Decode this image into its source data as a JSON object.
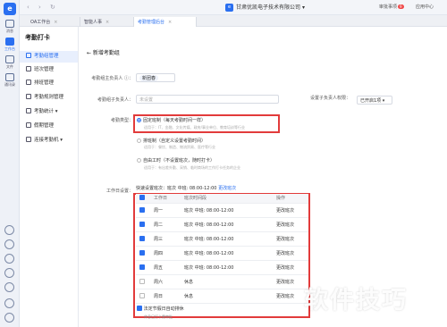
{
  "rail": {
    "logo": "e",
    "items": [
      "消息",
      "工作台",
      "文件",
      "通讯录"
    ],
    "active_index": 1
  },
  "topbar": {
    "nav": "‹ › ↻",
    "company": "甘肃优凯电子技术有限公司",
    "company_suffix": "▾",
    "right_items": [
      {
        "label": "审批事项",
        "badge": "9"
      },
      {
        "label": "应用中心",
        "badge": ""
      }
    ]
  },
  "tabs": [
    {
      "label": "OA工作台",
      "close": "×"
    },
    {
      "label": "智能人事",
      "close": "×"
    },
    {
      "label": "考勤管理后台",
      "close": "×"
    }
  ],
  "sidebar": {
    "title": "考勤打卡",
    "items": [
      {
        "label": "考勤组管理"
      },
      {
        "label": "班次管理"
      },
      {
        "label": "排班管理"
      },
      {
        "label": "考勤规则管理"
      },
      {
        "label": "考勤统计 ▾"
      },
      {
        "label": "假期管理"
      },
      {
        "label": "连接考勤机 ▾"
      }
    ],
    "active_index": 0
  },
  "form": {
    "back_label": "← 新增考勤组",
    "owner_label": "考勤组主负责人 ⓘ：",
    "owner_value": "新团春",
    "sub_owner_label": "考勤组子负责人：",
    "sub_owner_placeholder": "未设置",
    "perm_label": "设置子负责人权限：",
    "perm_value": "已开启1项 ▾",
    "type_label": "考勤类型：",
    "types": [
      {
        "title": "固定班制（每天考勤时间一样）",
        "desc": "适用于：IT、金融、文化传媒、政府/事业单位、教育培训等行业"
      },
      {
        "title": "排班制（自定义设置考勤时间）",
        "desc": "适用于：餐饮、制造、物流贸易、医疗等行业"
      },
      {
        "title": "自由工时（不设置班次，随时打卡）",
        "desc": "适用于：有出差外勤、采销、临时商场的工作打卡任务的企业"
      }
    ],
    "selected_type": 0,
    "workday_label": "工作日设置：",
    "quick_set": "快速设置班次：班次 中班: 08:00-12:00",
    "quick_change": "更改班次",
    "table_headers": [
      "工作日",
      "班次时间段",
      "操作"
    ],
    "rows": [
      {
        "day": "周一",
        "shift": "班次 中班: 08:00-12:00",
        "op": "更改班次",
        "checked": true
      },
      {
        "day": "周二",
        "shift": "班次 中班: 08:00-12:00",
        "op": "更改班次",
        "checked": true
      },
      {
        "day": "周三",
        "shift": "班次 中班: 08:00-12:00",
        "op": "更改班次",
        "checked": true
      },
      {
        "day": "周四",
        "shift": "班次 中班: 08:00-12:00",
        "op": "更改班次",
        "checked": true
      },
      {
        "day": "周五",
        "shift": "班次 中班: 08:00-12:00",
        "op": "更改班次",
        "checked": true
      },
      {
        "day": "周六",
        "shift": "休息",
        "op": "更改班次",
        "checked": false
      },
      {
        "day": "周日",
        "shift": "休息",
        "op": "更改班次",
        "checked": false
      }
    ],
    "holiday_label": "法定节假日自动排休",
    "holiday_sub": "休息日打卡需审批"
  },
  "watermark": "软件技巧",
  "colors": {
    "accent": "#2a6ff0",
    "highlight": "#e23b3b"
  }
}
